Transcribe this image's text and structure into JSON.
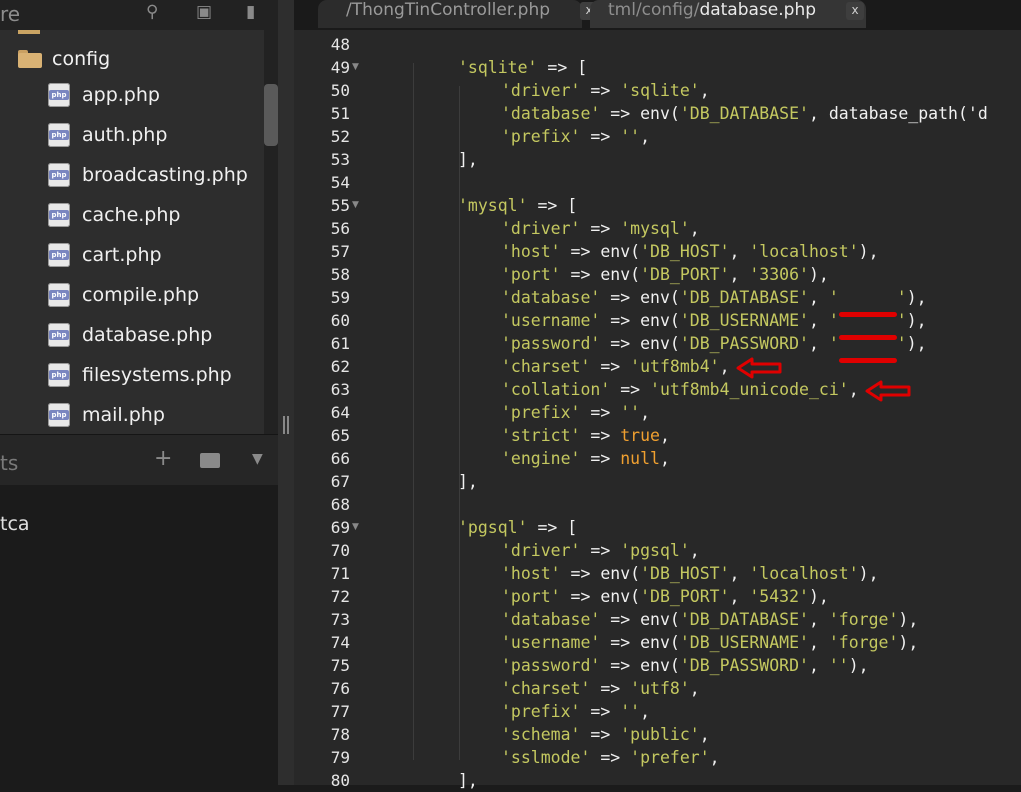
{
  "sidebar": {
    "top_fragment": "re",
    "folder": "config",
    "files": [
      "app.php",
      "auth.php",
      "broadcasting.php",
      "cache.php",
      "cart.php",
      "compile.php",
      "database.php",
      "filesystems.php",
      "mail.php"
    ],
    "file_icon_text": "php",
    "section_fragment": "ts",
    "bottom_fragment": "tca"
  },
  "tabs": [
    {
      "label": "/ThongTinController.php",
      "close": "x"
    },
    {
      "label_prefix": "tml/config/",
      "label_main": "database.php",
      "close": "x"
    }
  ],
  "code": {
    "lines": [
      {
        "n": "48",
        "t": ""
      },
      {
        "n": "49",
        "t": "'sqlite' => [",
        "fold": true
      },
      {
        "n": "50",
        "t": "'driver' => 'sqlite',"
      },
      {
        "n": "51",
        "t": "'database' => env('DB_DATABASE', database_path('d"
      },
      {
        "n": "52",
        "t": "'prefix' => '',"
      },
      {
        "n": "53",
        "t": "],"
      },
      {
        "n": "54",
        "t": ""
      },
      {
        "n": "55",
        "t": "'mysql' => [",
        "fold": true
      },
      {
        "n": "56",
        "t": "'driver' => 'mysql',"
      },
      {
        "n": "57",
        "t": "'host' => env('DB_HOST', 'localhost'),"
      },
      {
        "n": "58",
        "t": "'port' => env('DB_PORT', '3306'),"
      },
      {
        "n": "59",
        "t": "'database' => env('DB_DATABASE', '[redacted]'),"
      },
      {
        "n": "60",
        "t": "'username' => env('DB_USERNAME', '[redacted]'),"
      },
      {
        "n": "61",
        "t": "'password' => env('DB_PASSWORD', '[redacted]'),"
      },
      {
        "n": "62",
        "t": "'charset' => 'utf8mb4',"
      },
      {
        "n": "63",
        "t": "'collation' => 'utf8mb4_unicode_ci',"
      },
      {
        "n": "64",
        "t": "'prefix' => '',"
      },
      {
        "n": "65",
        "t": "'strict' => true,"
      },
      {
        "n": "66",
        "t": "'engine' => null,"
      },
      {
        "n": "67",
        "t": "],"
      },
      {
        "n": "68",
        "t": ""
      },
      {
        "n": "69",
        "t": "'pgsql' => [",
        "fold": true
      },
      {
        "n": "70",
        "t": "'driver' => 'pgsql',"
      },
      {
        "n": "71",
        "t": "'host' => env('DB_HOST', 'localhost'),"
      },
      {
        "n": "72",
        "t": "'port' => env('DB_PORT', '5432'),"
      },
      {
        "n": "73",
        "t": "'database' => env('DB_DATABASE', 'forge'),"
      },
      {
        "n": "74",
        "t": "'username' => env('DB_USERNAME', 'forge'),"
      },
      {
        "n": "75",
        "t": "'password' => env('DB_PASSWORD', ''),"
      },
      {
        "n": "76",
        "t": "'charset' => 'utf8',"
      },
      {
        "n": "77",
        "t": "'prefix' => '',"
      },
      {
        "n": "78",
        "t": "'schema' => 'public',"
      },
      {
        "n": "79",
        "t": "'sslmode' => 'prefer',"
      },
      {
        "n": "80",
        "t": "],"
      }
    ],
    "arrows_on_lines": [
      "62",
      "63"
    ]
  },
  "colors": {
    "string": "#c4c860",
    "keyword": "#f0a030",
    "redaction": "#e00000",
    "arrow": "#e00000",
    "folder": "#d9b274"
  }
}
